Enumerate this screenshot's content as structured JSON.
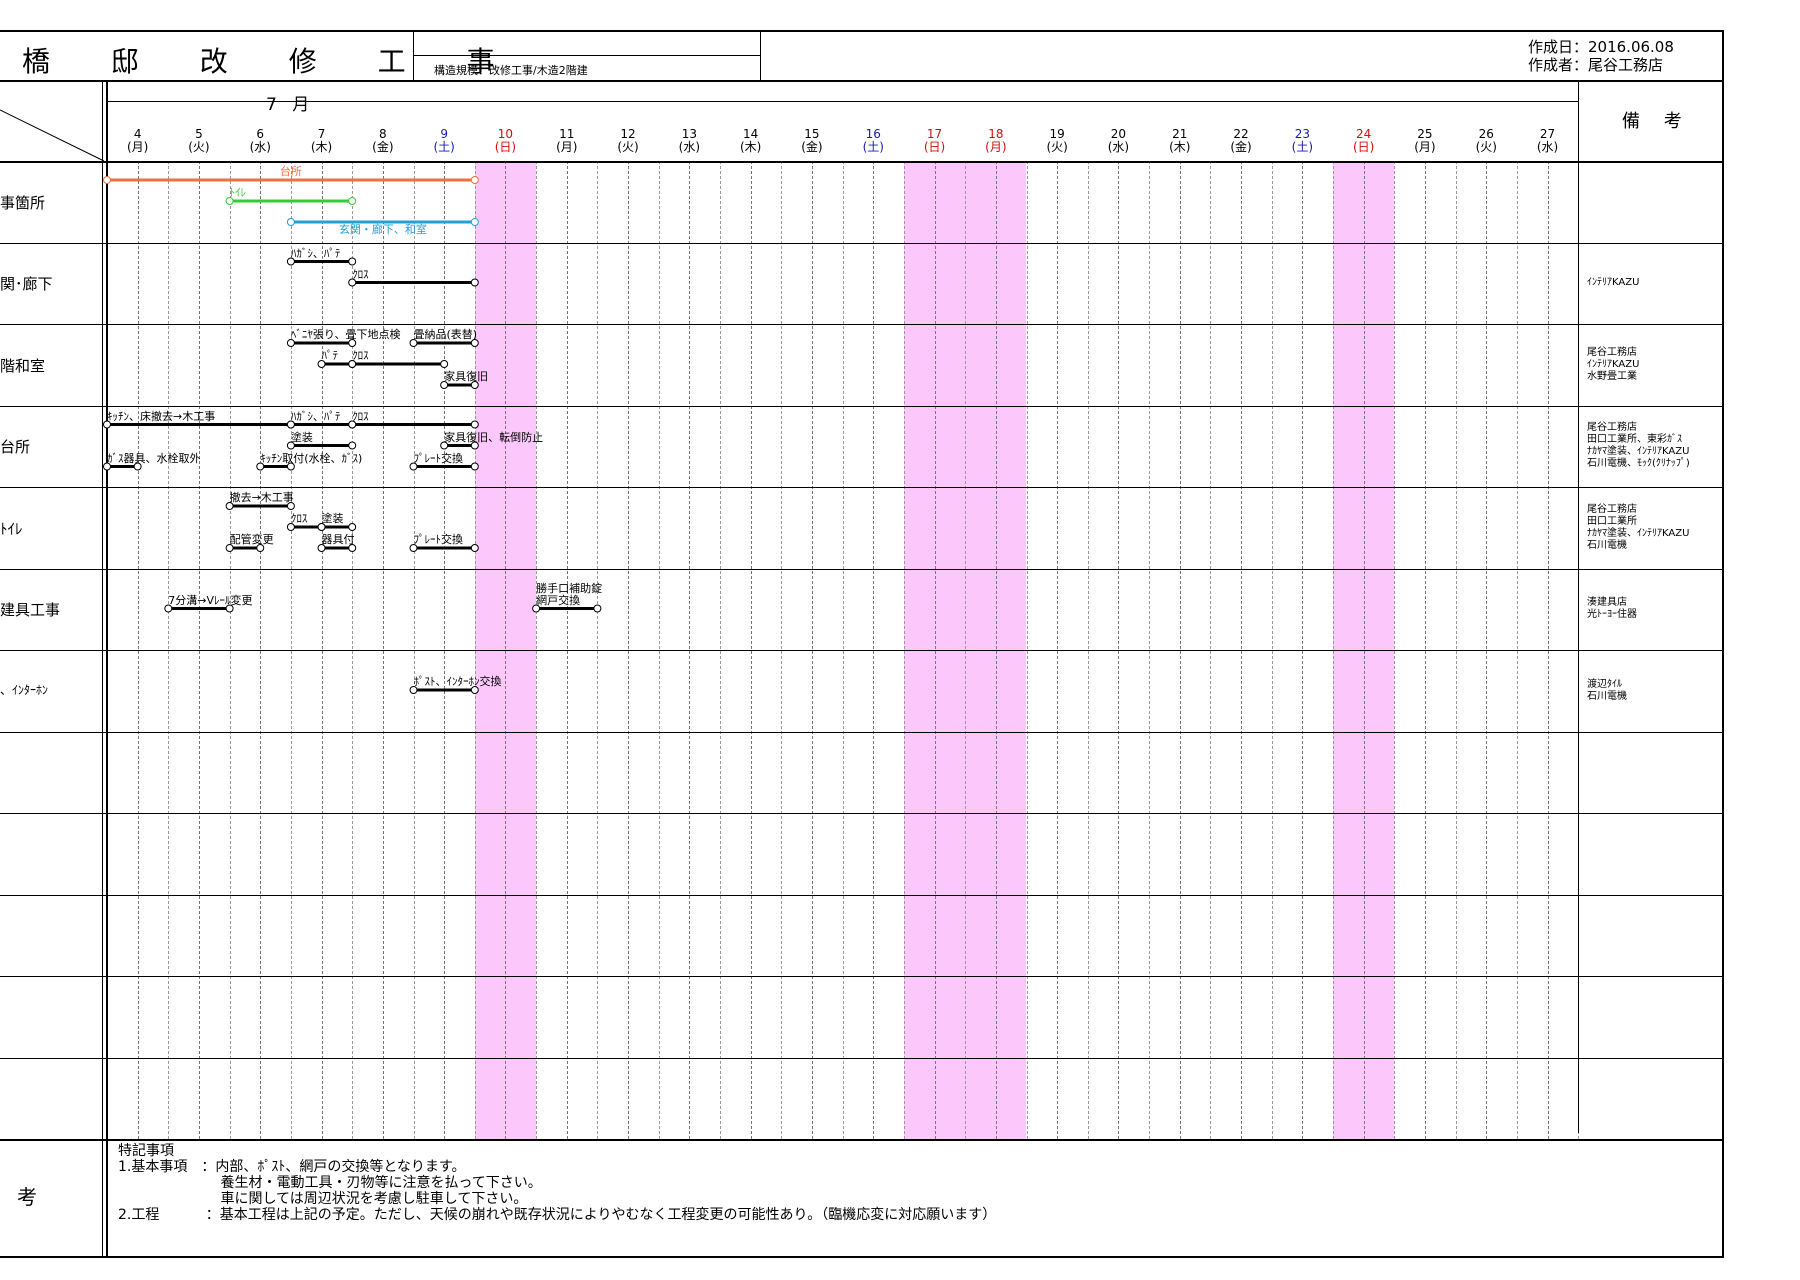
{
  "header": {
    "title": "橋 邸 改 修 工 事",
    "structure": "構造規模：改修工事/木造2階建",
    "created_date": "作成日：2016.06.08",
    "created_by": "作成者：尾谷工務店"
  },
  "calendar": {
    "month_label": "7 月",
    "remarks_header": "備 考",
    "days": [
      {
        "d": "4",
        "w": "(月)",
        "c": "#000"
      },
      {
        "d": "5",
        "w": "(火)",
        "c": "#000"
      },
      {
        "d": "6",
        "w": "(水)",
        "c": "#000"
      },
      {
        "d": "7",
        "w": "(木)",
        "c": "#000"
      },
      {
        "d": "8",
        "w": "(金)",
        "c": "#000"
      },
      {
        "d": "9",
        "w": "(土)",
        "c": "#1a1ab0"
      },
      {
        "d": "10",
        "w": "(日)",
        "c": "#d01010"
      },
      {
        "d": "11",
        "w": "(月)",
        "c": "#000"
      },
      {
        "d": "12",
        "w": "(火)",
        "c": "#000"
      },
      {
        "d": "13",
        "w": "(水)",
        "c": "#000"
      },
      {
        "d": "14",
        "w": "(木)",
        "c": "#000"
      },
      {
        "d": "15",
        "w": "(金)",
        "c": "#000"
      },
      {
        "d": "16",
        "w": "(土)",
        "c": "#1a1ab0"
      },
      {
        "d": "17",
        "w": "(日)",
        "c": "#d01010"
      },
      {
        "d": "18",
        "w": "(月)",
        "c": "#d01010"
      },
      {
        "d": "19",
        "w": "(火)",
        "c": "#000"
      },
      {
        "d": "20",
        "w": "(水)",
        "c": "#000"
      },
      {
        "d": "21",
        "w": "(木)",
        "c": "#000"
      },
      {
        "d": "22",
        "w": "(金)",
        "c": "#000"
      },
      {
        "d": "23",
        "w": "(土)",
        "c": "#1a1ab0"
      },
      {
        "d": "24",
        "w": "(日)",
        "c": "#d01010"
      },
      {
        "d": "25",
        "w": "(月)",
        "c": "#000"
      },
      {
        "d": "26",
        "w": "(火)",
        "c": "#000"
      },
      {
        "d": "27",
        "w": "(水)",
        "c": "#000"
      }
    ],
    "holiday_days": [
      "10",
      "17",
      "18",
      "24"
    ]
  },
  "rows": [
    {
      "label": "事箇所",
      "remarks": []
    },
    {
      "label": "関･廊下",
      "remarks": [
        "ｲﾝﾃﾘｱKAZU"
      ]
    },
    {
      "label": "階和室",
      "remarks": [
        "尾谷工務店",
        "ｲﾝﾃﾘｱKAZU",
        "水野畳工業"
      ]
    },
    {
      "label": "台所",
      "remarks": [
        "尾谷工務店",
        "田口工業所、東彩ｶﾞｽ",
        "ﾅｶﾔﾏ塗装、ｲﾝﾃﾘｱKAZU",
        "石川電機、ﾓｯｸ(ｸﾘﾅｯﾌﾟ)"
      ]
    },
    {
      "label": "ﾄｲﾚ",
      "remarks": [
        "尾谷工務店",
        "田口工業所",
        "ﾅｶﾔﾏ塗装、ｲﾝﾃﾘｱKAZU",
        "石川電機"
      ]
    },
    {
      "label": "建具工事",
      "remarks": [
        "湊建具店",
        "光ﾄｰﾖｰ住器"
      ]
    },
    {
      "label": "、ｲﾝﾀｰﾎﾝ",
      "remarks": [
        "渡辺ﾀｲﾙ",
        "石川電機"
      ]
    },
    {
      "label": "",
      "remarks": []
    },
    {
      "label": "",
      "remarks": []
    },
    {
      "label": "",
      "remarks": []
    },
    {
      "label": "",
      "remarks": []
    },
    {
      "label": "",
      "remarks": []
    }
  ],
  "tasks": [
    {
      "row": 0,
      "slot": 0,
      "start": 4,
      "end": 10,
      "label": "台所",
      "color": "#f07040",
      "label_color": "#f07040"
    },
    {
      "row": 0,
      "slot": 1,
      "start": 6,
      "end": 8,
      "label": "ﾄｲﾚ",
      "color": "#33cc33",
      "label_color": "#33cc33"
    },
    {
      "row": 0,
      "slot": 2,
      "start": 7,
      "end": 10,
      "label": "玄関・廊下、和室",
      "color": "#20a0dd",
      "label_color": "#20a0dd",
      "below": true
    },
    {
      "row": 1,
      "slot": 0,
      "start": 7,
      "end": 8,
      "label": "ﾊｶﾞｼ、ﾊﾟﾃ",
      "color": "#000"
    },
    {
      "row": 1,
      "slot": 1,
      "start": 8,
      "end": 10,
      "label": "ｸﾛｽ",
      "color": "#000"
    },
    {
      "row": 2,
      "slot": 0,
      "start": 7,
      "end": 8,
      "label": "ﾍﾞﾆﾔ張り、畳下地点検",
      "color": "#000"
    },
    {
      "row": 2,
      "slot": 0,
      "start": 9,
      "end": 10,
      "label": "畳納品(表替)",
      "color": "#000"
    },
    {
      "row": 2,
      "slot": 1,
      "start": 7.5,
      "end": 8,
      "label": "ﾊﾟﾃ",
      "color": "#000"
    },
    {
      "row": 2,
      "slot": 1,
      "start": 8,
      "end": 9.5,
      "label": "ｸﾛｽ",
      "color": "#000"
    },
    {
      "row": 2,
      "slot": 2,
      "start": 9.5,
      "end": 10,
      "label": "家具復旧",
      "color": "#000"
    },
    {
      "row": 3,
      "slot": 0,
      "start": 4,
      "end": 7,
      "label": "ｷｯﾁﾝ、床撤去→木工事",
      "color": "#000"
    },
    {
      "row": 3,
      "slot": 0,
      "start": 7,
      "end": 8,
      "label": "ﾊｶﾞｼ、ﾊﾟﾃ",
      "color": "#000"
    },
    {
      "row": 3,
      "slot": 0,
      "start": 8,
      "end": 10,
      "label": "ｸﾛｽ",
      "color": "#000"
    },
    {
      "row": 3,
      "slot": 1,
      "start": 7,
      "end": 8,
      "label": "塗装",
      "color": "#000"
    },
    {
      "row": 3,
      "slot": 1,
      "start": 9.5,
      "end": 10,
      "label": "家具復旧、転倒防止",
      "color": "#000"
    },
    {
      "row": 3,
      "slot": 2,
      "start": 4,
      "end": 4.5,
      "label": "ｶﾞｽ器具、水栓取外",
      "color": "#000"
    },
    {
      "row": 3,
      "slot": 2,
      "start": 6.5,
      "end": 7,
      "label": "ｷｯﾁﾝ取付(水栓、ｶﾞｽ)",
      "color": "#000"
    },
    {
      "row": 3,
      "slot": 2,
      "start": 9,
      "end": 10,
      "label": "ﾌﾟﾚｰﾄ交換",
      "color": "#000"
    },
    {
      "row": 4,
      "slot": 0,
      "start": 6,
      "end": 7,
      "label": "撤去→木工事",
      "color": "#000"
    },
    {
      "row": 4,
      "slot": 1,
      "start": 7,
      "end": 7.5,
      "label": "ｸﾛｽ",
      "color": "#000"
    },
    {
      "row": 4,
      "slot": 1,
      "start": 7.5,
      "end": 8,
      "label": "塗装",
      "color": "#000"
    },
    {
      "row": 4,
      "slot": 2,
      "start": 6,
      "end": 6.5,
      "label": "配管変更",
      "color": "#000"
    },
    {
      "row": 4,
      "slot": 2,
      "start": 7.5,
      "end": 8,
      "label": "器具付",
      "color": "#000"
    },
    {
      "row": 4,
      "slot": 2,
      "start": 9,
      "end": 10,
      "label": "ﾌﾟﾚｰﾄ交換",
      "color": "#000"
    },
    {
      "row": 5,
      "slot": 1,
      "start": 5,
      "end": 6,
      "label": "7分溝→Vﾚｰﾙ変更",
      "color": "#000"
    },
    {
      "row": 5,
      "slot": 1,
      "start": 11,
      "end": 12,
      "label": "勝手口補助錠",
      "label2": "網戸交換",
      "color": "#000"
    },
    {
      "row": 6,
      "slot": 1,
      "start": 9,
      "end": 10,
      "label": "ﾎﾟｽﾄ、ｲﾝﾀｰﾎﾝ交換",
      "color": "#000"
    }
  ],
  "notes": {
    "label": "考",
    "lines": [
      "特記事項",
      "1.基本事項　：内部、ﾎﾟｽﾄ、網戸の交換等となります。",
      "　　　　　　　 養生材・電動工具・刃物等に注意を払って下さい。",
      "　　　　　　　 車に関しては周辺状況を考慮し駐車して下さい。",
      "2.工程　　　 ：基本工程は上記の予定。ただし、天候の崩れや既存状況によりやむなく工程変更の可能性あり。（臨機応変に対応願います）"
    ]
  }
}
